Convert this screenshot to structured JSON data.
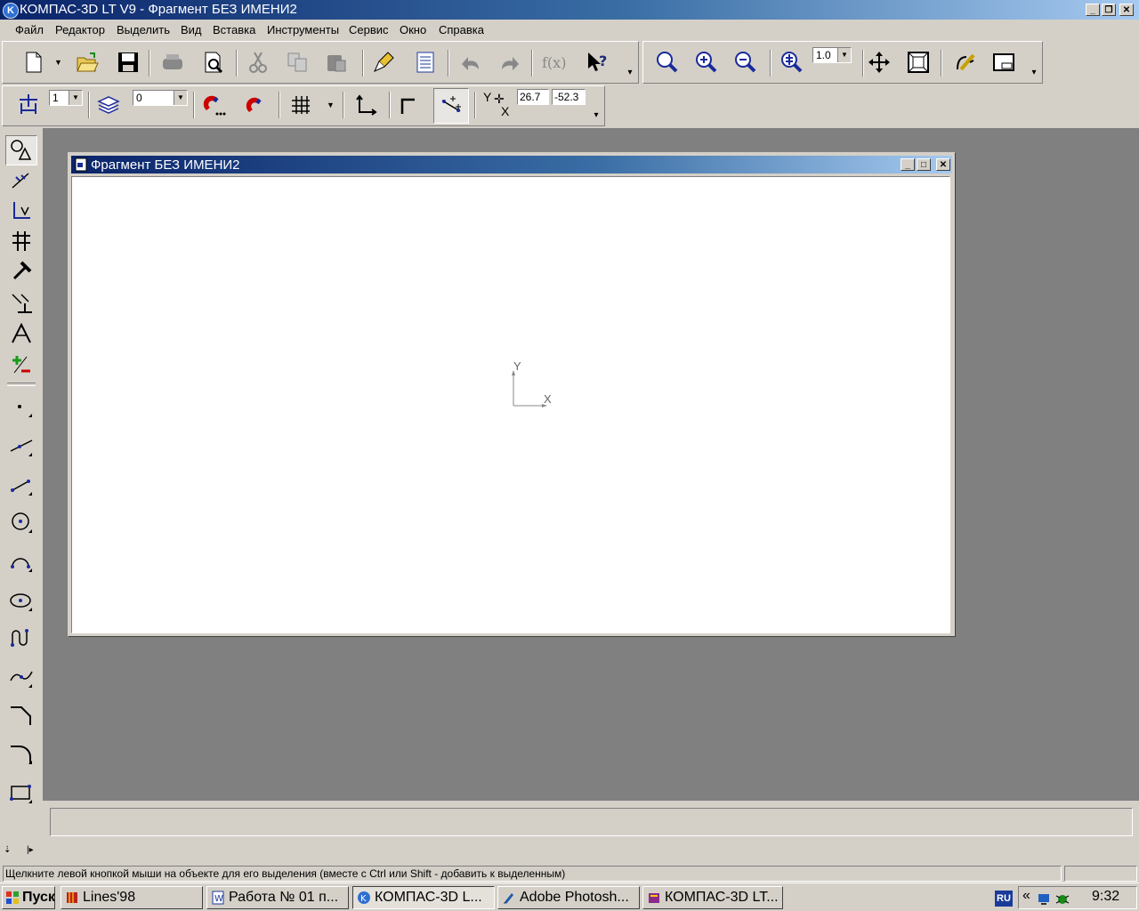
{
  "app": {
    "title": "КОМПАС-3D LT V9 - Фрагмент БЕЗ ИМЕНИ2",
    "logo_letter": "K"
  },
  "menu": [
    "Файл",
    "Редактор",
    "Выделить",
    "Вид",
    "Вставка",
    "Инструменты",
    "Сервис",
    "Окно",
    "Справка"
  ],
  "toolbar": {
    "zoom_value": "1.0",
    "step_value": "1",
    "layer_value": "0",
    "coord_x": "26.7",
    "coord_y": "-52.3",
    "coord_label_y": "Y",
    "coord_label_x": "X"
  },
  "document": {
    "title": "Фрагмент БЕЗ ИМЕНИ2",
    "axis_x": "X",
    "axis_y": "Y"
  },
  "status": {
    "hint": "Щелкните левой кнопкой мыши на объекте для его выделения (вместе с Ctrl или Shift - добавить к выделенным)"
  },
  "taskbar": {
    "start": "Пуск",
    "tasks": [
      "Lines'98",
      "Работа № 01 п...",
      "КОМПАС-3D L...",
      "Adobe Photosh...",
      "КОМПАС-3D LT..."
    ],
    "lang": "RU",
    "clock": "9:32",
    "chevron": "«"
  },
  "colors": {
    "title_active": "#0a246a",
    "workspace": "#808080",
    "face": "#d4d0c8"
  }
}
